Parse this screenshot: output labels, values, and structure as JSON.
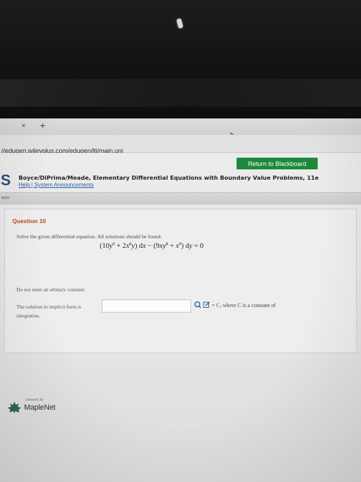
{
  "browser": {
    "tab_close": "×",
    "tab_new": "+",
    "url": "//edugen.wileyplus.com/edugen/lti/main.uni"
  },
  "header": {
    "return_button": "Return to Blackboard",
    "logo_letter": "S",
    "book_title": "Boyce/DiPrima/Meade, Elementary Differential Equations with Boundary Value Problems, 11e",
    "help_links": "Help | System Announcements",
    "subbar_label": "MER"
  },
  "question": {
    "title": "Question 10",
    "instruction": "Solve the given differential equation. All solutions should be found.",
    "hint": "Do not enter an arbitary constant.",
    "answer_label": "The solution in implicit form is",
    "answer_value": "",
    "suffix_text": "= C, where C is a constant of",
    "suffix_text_2": "integration."
  },
  "footer": {
    "powered_by": "powered by",
    "brand": "MapleNet"
  },
  "colors": {
    "button_green": "#1d8a3b",
    "question_title": "#b24a1f",
    "link_blue": "#2a5ca8"
  }
}
